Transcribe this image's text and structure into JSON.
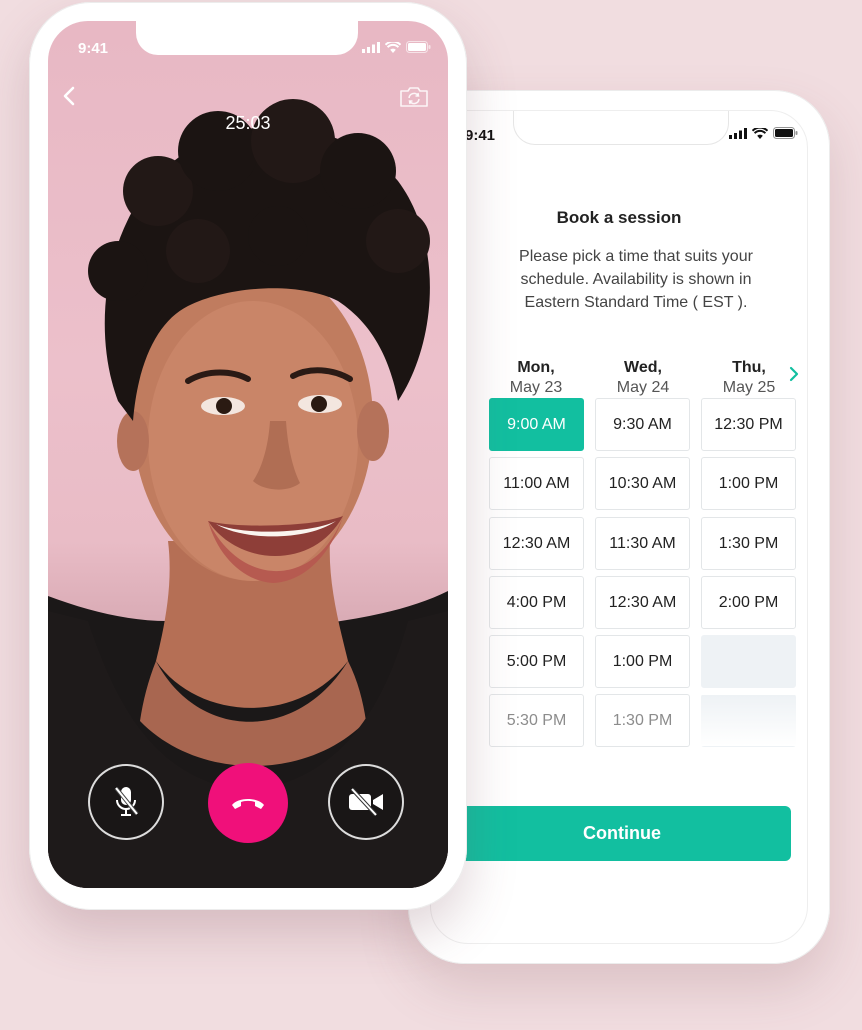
{
  "booking_phone": {
    "status_time": "9:41",
    "title": "Book a session",
    "description": "Please pick a time that suits your schedule. Availability is shown in Eastern Standard Time ( EST ).",
    "days": [
      {
        "name": "Mon,",
        "date": "May 23"
      },
      {
        "name": "Wed,",
        "date": "May 24"
      },
      {
        "name": "Thu,",
        "date": "May 25"
      }
    ],
    "next_icon": "chevron-right-icon",
    "slots": [
      [
        "9:00 AM",
        "11:00 AM",
        "12:30 AM",
        "4:00 PM",
        "5:00 PM",
        "5:30 PM"
      ],
      [
        "9:30 AM",
        "10:30 AM",
        "11:30 AM",
        "12:30 AM",
        "1:00 PM",
        "1:30 PM"
      ],
      [
        "12:30 PM",
        "1:00 PM",
        "1:30 PM",
        "2:00 PM",
        "",
        ""
      ]
    ],
    "selected_slot": "9:00 AM",
    "continue_label": "Continue",
    "accent_color": "#12bfa0"
  },
  "call_phone": {
    "status_time": "9:41",
    "timer": "25:03",
    "icons": [
      "back-chevron-icon",
      "camera-switch-icon",
      "mic-off-icon",
      "end-call-icon",
      "video-off-icon"
    ],
    "end_call_color": "#f0107a"
  }
}
